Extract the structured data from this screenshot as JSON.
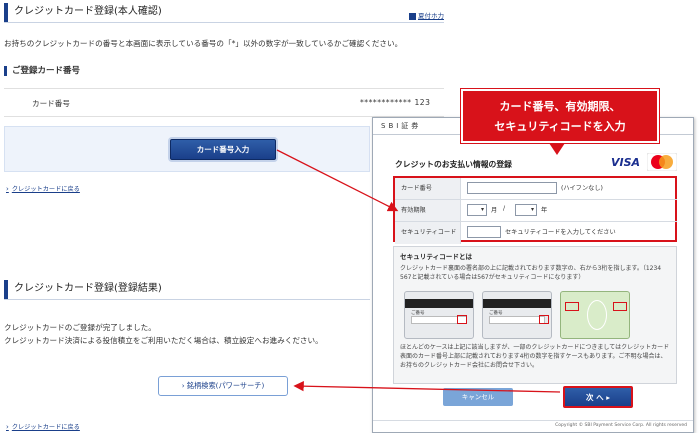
{
  "top_section": {
    "title": "クレジットカード登録(本人確認)",
    "print_label": "夏付ホ力",
    "intro": "お持ちのクレジットカードの番号と本画面に表示している番号の「*」以外の数字が一致しているかご確認ください。",
    "subheading": "ご登録カード番号",
    "card_label": "カード番号",
    "card_value": "************ 123",
    "card_input_button": "カード番号入力",
    "back_link": "クレジットカードに戻る"
  },
  "result_section": {
    "title": "クレジットカード登録(登録結果)",
    "line1": "クレジットカードのご登録が完了しました。",
    "line2": "クレジットカード決済による投信積立をご利用いただく場合は、積立設定へお進みください。",
    "search_button": "銘柄検索(パワーサーチ)",
    "back_link": "クレジットカードに戻る"
  },
  "callout": {
    "line1": "カード番号、有効期限、",
    "line2": "セキュリティコードを入力"
  },
  "sbi_window": {
    "bar_title": "SBI証券",
    "form_title": "クレジットのお支払い情報の登録",
    "visa_label": "VISA",
    "mc_label": "MasterCard",
    "rows": [
      {
        "label": "カード番号",
        "hint": "(ハイフンなし)"
      },
      {
        "label": "有効期限",
        "month_label": "月",
        "separator": "/",
        "year_label": "年"
      },
      {
        "label": "セキュリティコード",
        "hint": "セキュリティコードを入力してください"
      }
    ],
    "security_box": {
      "title": "セキュリティコードとは",
      "text": "クレジットカード裏面の署名部の上に記載されております数字の、右から3桁を指します。（1234 567と記載されている場合は567がセキュリティコードになります）",
      "card_label": "ご番号",
      "note": "ほとんどのケースは上記に該当しますが、一部のクレジットカードにつきましてはクレジットカード表面のカード番号上部に記載されております4桁の数字を指すケースもあります。ご不明な場合は、お持ちのクレジットカード会社にお問合せ下さい。"
    },
    "cancel_button": "キャンセル",
    "next_button": "次 へ",
    "copyright": "Copyright © SBI Payment Service Corp. All rights reserved"
  },
  "colors": {
    "accent": "#1a3f8a",
    "highlight": "#d8121a"
  }
}
